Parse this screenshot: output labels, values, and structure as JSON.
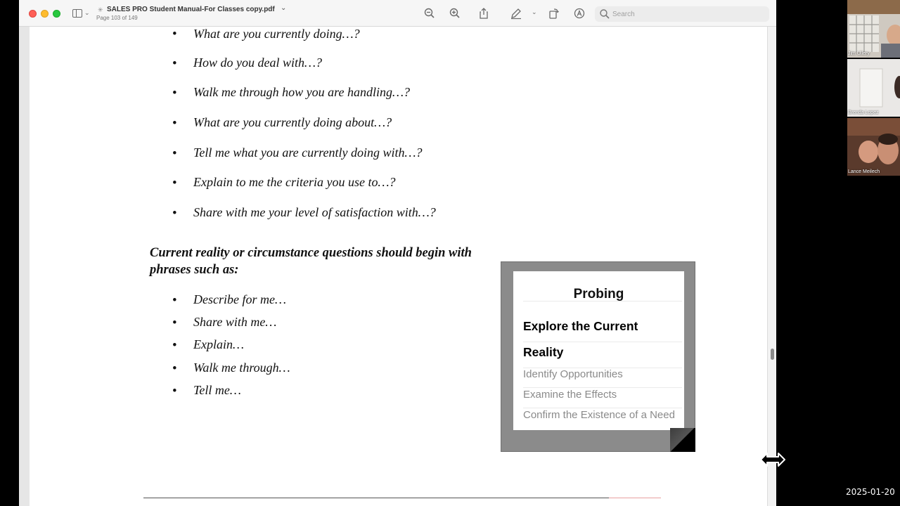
{
  "toolbar": {
    "title": "SALES PRO Student Manual-For Classes copy.pdf",
    "subtitle": "Page 103 of 149",
    "search_placeholder": "Search"
  },
  "page": {
    "bullets_top": [
      "What are you currently doing…?",
      "How do you deal with…?",
      "Walk me through how you are handling…?",
      "What are you currently doing about…?",
      "Tell me what you are currently doing with…?",
      "Explain to me the criteria you use to…?",
      "Share with me your level of satisfaction with…?"
    ],
    "heading": "Current reality or circumstance questions should begin with phrases such as:",
    "bullets_bottom": [
      "Describe for me…",
      "Share with me…",
      "Explain…",
      "Walk me through…",
      "Tell me…"
    ],
    "probing": {
      "title": "Probing",
      "active_line1": "Explore the Current",
      "active_line2": "Reality",
      "items": [
        "Identify Opportunities",
        "Examine the Effects",
        "Confirm the Existence of a Need"
      ]
    }
  },
  "participants": [
    {
      "name": "Jim Ullery"
    },
    {
      "name": "Brenda Lopez"
    },
    {
      "name": "Lance Meilech"
    }
  ],
  "timestamp": "2025-01-20",
  "colors": {
    "close": "#fe5f57",
    "minimize": "#febc2e",
    "zoom": "#28c840"
  }
}
